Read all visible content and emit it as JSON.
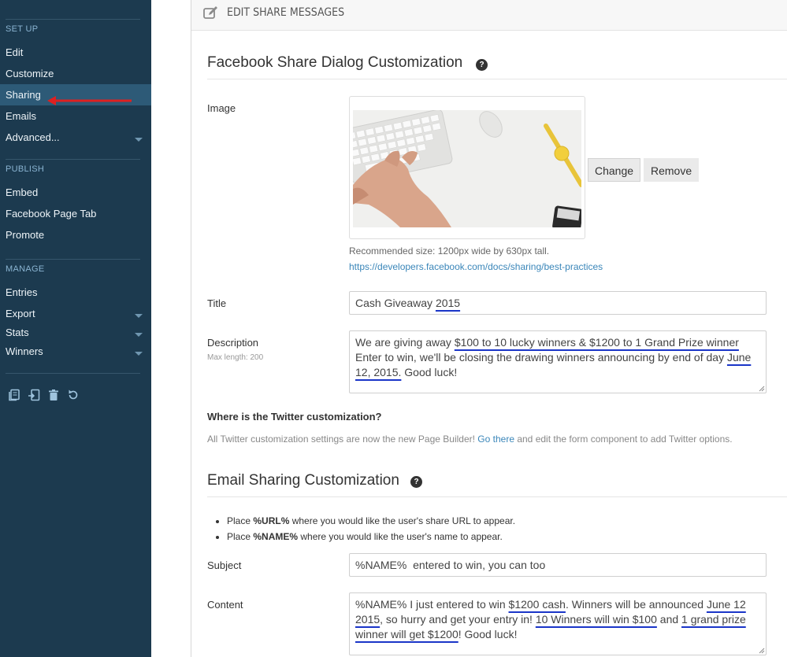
{
  "sidebar": {
    "sections": [
      {
        "title": "SET UP",
        "items": [
          {
            "label": "Edit"
          },
          {
            "label": "Customize"
          },
          {
            "label": "Sharing"
          },
          {
            "label": "Emails"
          },
          {
            "label": "Advanced..."
          }
        ]
      },
      {
        "title": "PUBLISH",
        "items": [
          {
            "label": "Embed"
          },
          {
            "label": "Facebook Page Tab"
          },
          {
            "label": "Promote"
          }
        ]
      },
      {
        "title": "MANAGE",
        "items": [
          {
            "label": "Entries"
          },
          {
            "label": "Export"
          },
          {
            "label": "Stats"
          },
          {
            "label": "Winners"
          }
        ]
      }
    ],
    "active_item": "Sharing",
    "tools": [
      "copy-icon",
      "import-icon",
      "trash-icon",
      "reset-icon"
    ]
  },
  "header": {
    "title": "EDIT SHARE MESSAGES",
    "icon": "edit-icon"
  },
  "facebook": {
    "title": "Facebook Share Dialog Customization",
    "help": "?",
    "image_label": "Image",
    "change_button": "Change",
    "remove_button": "Remove",
    "recommended": "Recommended size: 1200px wide by 630px tall.",
    "link": "https://developers.facebook.com/docs/sharing/best-practices",
    "title_label": "Title",
    "title_value_a": "Cash Giveaway ",
    "title_value_b": "2015",
    "desc_label": "Description",
    "desc_max": "Max length: 200",
    "desc_a": "We are giving away ",
    "desc_b": "$100 to 10 lucky winners & $1200 to 1 Grand Prize winner",
    "desc_c": " Enter to win, we'll be closing the drawing winners announcing by end of day ",
    "desc_d": "June 12, 2015.",
    "desc_e": " Good luck!"
  },
  "twitter": {
    "heading": "Where is the Twitter customization?",
    "text_a": "All Twitter customization settings are now the new Page Builder! ",
    "link": "Go there",
    "text_b": " and edit the form component to add Twitter options."
  },
  "email": {
    "title": "Email Sharing Customization",
    "help": "?",
    "bullet1_a": "Place ",
    "bullet1_b": "%URL%",
    "bullet1_c": " where you would like the user's share URL to appear.",
    "bullet2_a": "Place ",
    "bullet2_b": "%NAME%",
    "bullet2_c": " where you would like the user's name to appear.",
    "subject_label": "Subject",
    "subject_value": "%NAME%  entered to win, you can too",
    "content_label": "Content",
    "content_a": "%NAME% I just entered to win ",
    "content_b": "$1200 cash",
    "content_c": ". Winners will be announced ",
    "content_d": "June 12 2015",
    "content_e": ", so hurry and get your entry in! ",
    "content_f": "10 Winners will win $100",
    "content_g": " and ",
    "content_h": "1 grand prize winner will get $1200",
    "content_i": "! Good luck!"
  },
  "colors": {
    "sidebar_bg": "#1c3a4f",
    "sidebar_active": "#2d5a77",
    "link": "#3a86b9",
    "annotation_red": "#e02020",
    "annotation_blue": "#1a35c8"
  }
}
